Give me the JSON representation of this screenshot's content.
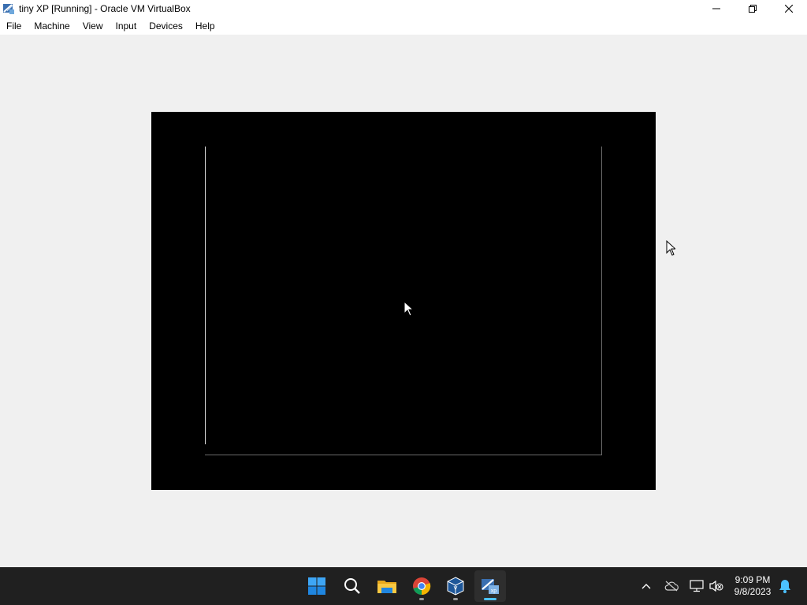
{
  "window": {
    "title": "tiny XP [Running] - Oracle VM VirtualBox"
  },
  "menu": {
    "items": [
      "File",
      "Machine",
      "View",
      "Input",
      "Devices",
      "Help"
    ]
  },
  "vm": {
    "state": "Running",
    "screen_color": "#000000"
  },
  "taskbar": {
    "apps": [
      {
        "name": "Start",
        "icon": "windows-start-icon"
      },
      {
        "name": "Search",
        "icon": "search-icon"
      },
      {
        "name": "File Explorer",
        "icon": "folder-icon"
      },
      {
        "name": "Google Chrome",
        "icon": "chrome-icon"
      },
      {
        "name": "Oracle VM VirtualBox",
        "icon": "virtualbox-icon"
      },
      {
        "name": "tiny XP",
        "icon": "vm-xp-icon"
      }
    ],
    "clock": {
      "time": "9:09 PM",
      "date": "9/8/2023"
    }
  },
  "colors": {
    "taskbar_bg": "#202020",
    "accent": "#4cc2ff",
    "window_bg": "#f0f0f0"
  }
}
